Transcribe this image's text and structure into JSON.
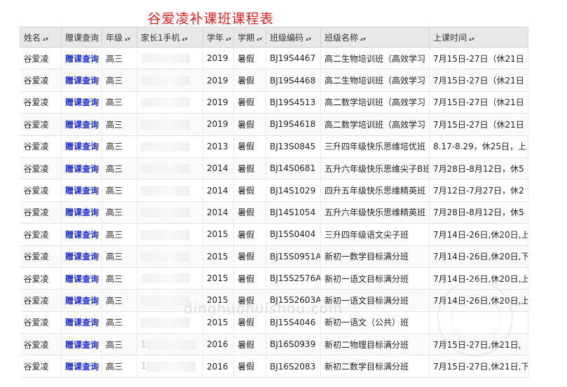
{
  "page": {
    "title": "谷爱凌补课班课程表"
  },
  "watermark": "dinghuohuishou.com",
  "table": {
    "columns": [
      "姓名",
      "赠课查询",
      "年级",
      "家长1手机",
      "学年",
      "学期",
      "班级编码",
      "班级名称",
      "上课时间"
    ],
    "sort_icon": "sort-icon",
    "rows": [
      {
        "name": "谷爱凌",
        "query": "赠课查询",
        "grade": "高三",
        "phone": "",
        "year": "2019",
        "term": "暑假",
        "code": "BJ19S4467",
        "class_name": "高二生物培训班（高效学习",
        "time": "7月15日-27日（休21日"
      },
      {
        "name": "谷爱凌",
        "query": "赠课查询",
        "grade": "高三",
        "phone": "",
        "year": "2019",
        "term": "暑假",
        "code": "BJ19S4468",
        "class_name": "高二生物培训班（高效学习",
        "time": "7月15日-27日（休21日"
      },
      {
        "name": "谷爱凌",
        "query": "赠课查询",
        "grade": "高三",
        "phone": "",
        "year": "2019",
        "term": "暑假",
        "code": "BJ19S4513",
        "class_name": "高二数学培训班（高效学习",
        "time": "7月15日-27日（休21日"
      },
      {
        "name": "谷爱凌",
        "query": "赠课查询",
        "grade": "高三",
        "phone": "",
        "year": "2019",
        "term": "暑假",
        "code": "BJ19S4618",
        "class_name": "高二数学培训班（高效学习",
        "time": "7月15日-27日（休21日"
      },
      {
        "name": "谷爱凌",
        "query": "赠课查询",
        "grade": "高三",
        "phone": "",
        "year": "2013",
        "term": "暑假",
        "code": "BJ13S0845",
        "class_name": "三升四年级快乐思维培优班",
        "time": "8.17-8.29，休25日，上"
      },
      {
        "name": "谷爱凌",
        "query": "赠课查询",
        "grade": "高三",
        "phone": "",
        "year": "2014",
        "term": "暑假",
        "code": "BJ14S0681",
        "class_name": "五升六年级快乐思维尖子B班",
        "time": "7月28日-8月12日，休5"
      },
      {
        "name": "谷爱凌",
        "query": "赠课查询",
        "grade": "高三",
        "phone": "",
        "year": "2014",
        "term": "暑假",
        "code": "BJ14S1029",
        "class_name": "四升五年级快乐思维精英班",
        "time": "7月12日-7月27日，休2"
      },
      {
        "name": "谷爱凌",
        "query": "赠课查询",
        "grade": "高三",
        "phone": "",
        "year": "2014",
        "term": "暑假",
        "code": "BJ14S1054",
        "class_name": "五升六年级快乐思维精英班",
        "time": "7月28日-8月12日，休5"
      },
      {
        "name": "谷爱凌",
        "query": "赠课查询",
        "grade": "高三",
        "phone": "",
        "year": "2015",
        "term": "暑假",
        "code": "BJ15S0404",
        "class_name": "三升四年级语文尖子班",
        "time": "7月14日-26日,休20日,上"
      },
      {
        "name": "谷爱凌",
        "query": "赠课查询",
        "grade": "高三",
        "phone": "",
        "year": "2015",
        "term": "暑假",
        "code": "BJ15S0951A",
        "class_name": "新初一数学目标满分班",
        "time": "7月14日-26日,休20日,下"
      },
      {
        "name": "谷爱凌",
        "query": "赠课查询",
        "grade": "高三",
        "phone": "",
        "year": "2015",
        "term": "暑假",
        "code": "BJ15S2576A",
        "class_name": "新初一语文目标满分班",
        "time": "7月14日-26日,休20日,上"
      },
      {
        "name": "谷爱凌",
        "query": "赠课查询",
        "grade": "高三",
        "phone": "",
        "year": "2015",
        "term": "暑假",
        "code": "BJ15S2603A",
        "class_name": "新初一语文目标满分班",
        "time": "7月14日-26日,休20日,上"
      },
      {
        "name": "谷爱凌",
        "query": "赠课查询",
        "grade": "高三",
        "phone": "",
        "year": "2015",
        "term": "暑假",
        "code": "BJ15S4046",
        "class_name": "新初一语文（公共）班",
        "time": ""
      },
      {
        "name": "谷爱凌",
        "query": "赠课查询",
        "grade": "高三",
        "phone": "1",
        "year": "2016",
        "term": "暑假",
        "code": "BJ16S0939",
        "class_name": "新初二物理目标满分班",
        "time": "7月15日-27日,休21日,"
      },
      {
        "name": "谷爱凌",
        "query": "赠课查询",
        "grade": "高三",
        "phone": "1",
        "year": "2016",
        "term": "暑假",
        "code": "BJ16S2083",
        "class_name": "新初二数学目标满分班",
        "time": "7月15日-27日,休21日,下"
      }
    ]
  }
}
